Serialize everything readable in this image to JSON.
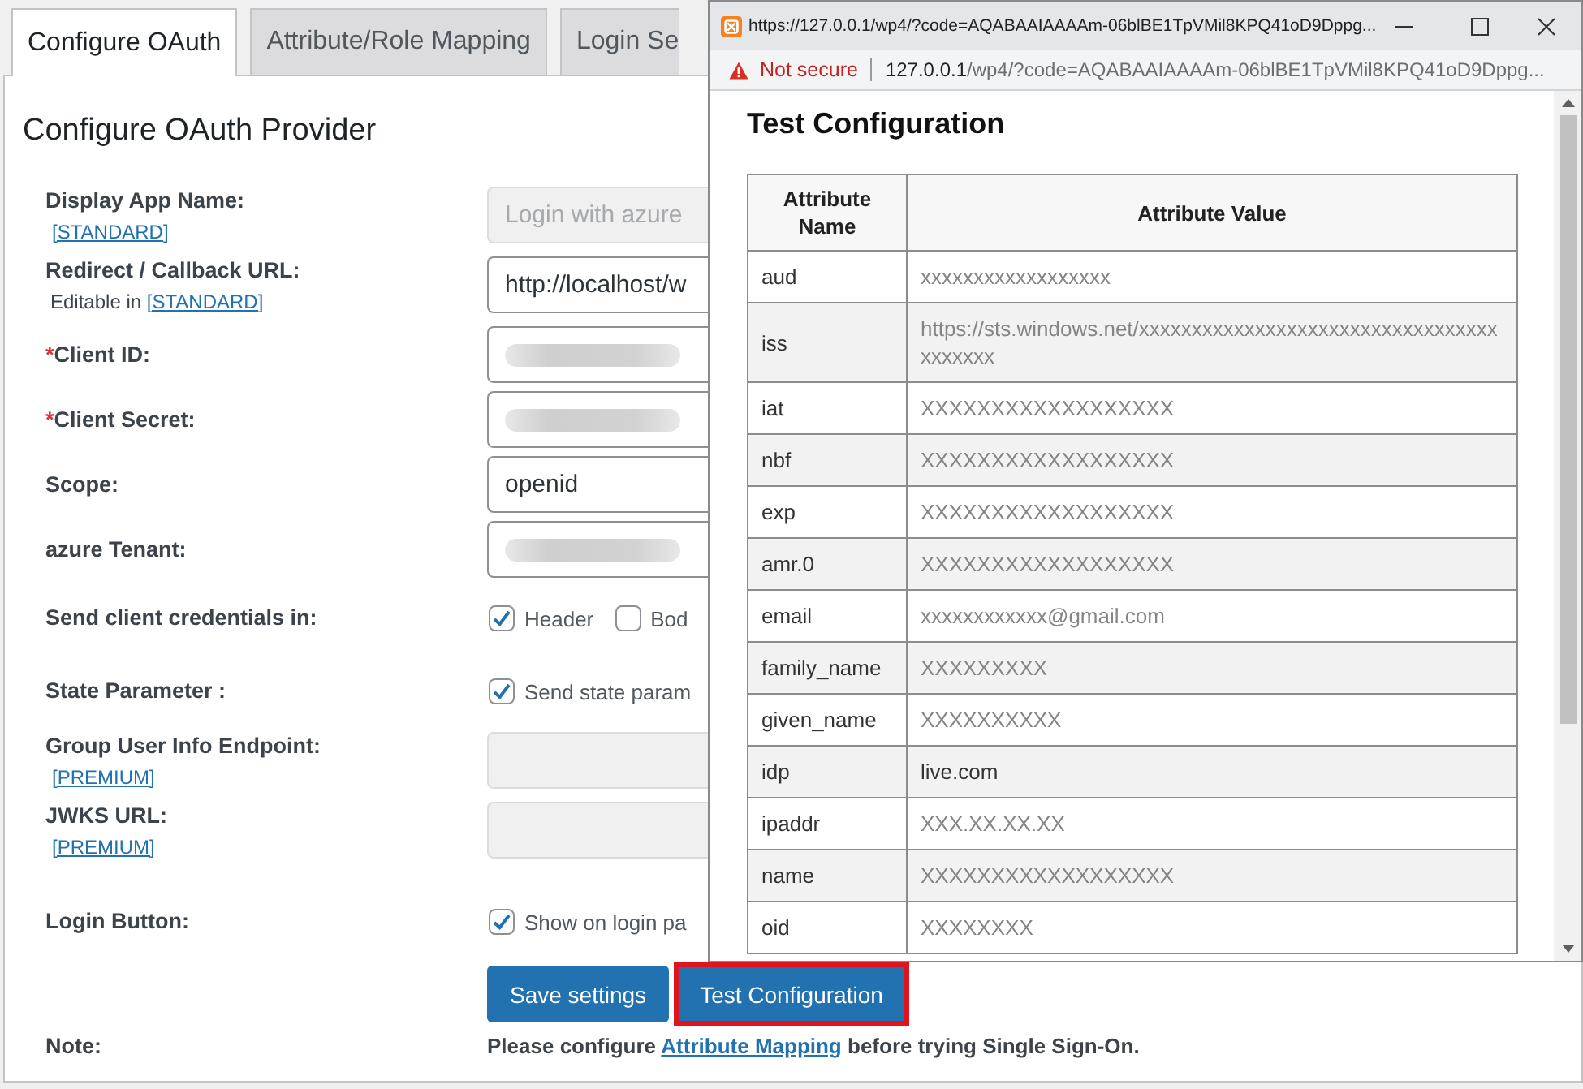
{
  "tabs": [
    {
      "label": "Configure OAuth",
      "selected": true
    },
    {
      "label": "Attribute/Role Mapping",
      "selected": false
    },
    {
      "label": "Login Se",
      "selected": false
    }
  ],
  "panel": {
    "title": "Configure OAuth Provider",
    "fields": [
      {
        "kind": "text",
        "label": "Display App Name:",
        "link": "[STANDARD]",
        "placeholder": "Login with azure",
        "disabled": true
      },
      {
        "kind": "text",
        "label": "Redirect / Callback URL:",
        "note": "Editable in",
        "link": "[STANDARD]",
        "value": "http://localhost/w",
        "disabled": false
      },
      {
        "kind": "secret",
        "label": "Client ID:",
        "required_mark": "*"
      },
      {
        "kind": "secret",
        "label": "Client Secret:",
        "required_mark": "*"
      },
      {
        "kind": "text",
        "label": "Scope:",
        "value": "openid",
        "disabled": false
      },
      {
        "kind": "secret",
        "label": "azure Tenant:"
      },
      {
        "kind": "checkboxes",
        "label": "Send client credentials in:",
        "options": [
          {
            "label": "Header",
            "checked": true
          },
          {
            "label": "Bod",
            "checked": false
          }
        ]
      },
      {
        "kind": "checkboxes",
        "label": "State Parameter :",
        "options": [
          {
            "label": "Send state param",
            "checked": true
          }
        ]
      },
      {
        "kind": "text",
        "label": "Group User Info Endpoint:",
        "link": "[PREMIUM]",
        "disabled": true
      },
      {
        "kind": "text",
        "label": "JWKS URL:",
        "link": "[PREMIUM]",
        "disabled": true
      },
      {
        "kind": "checkboxes",
        "label": "Login Button:",
        "options": [
          {
            "label": "Show on login pa",
            "checked": true
          }
        ]
      }
    ]
  },
  "buttons": [
    {
      "label": "Save settings",
      "highlighted": false
    },
    {
      "label": "Test Configuration",
      "highlighted": true
    }
  ],
  "note": {
    "label": "Note:",
    "before": "Please configure",
    "link": "Attribute Mapping",
    "after": "before trying Single Sign-On."
  },
  "popup": {
    "tab_url": "https://127.0.0.1/wp4/?code=AQABAAIAAAAm-06blBE1TpVMil8KPQ41oD9Dppg...",
    "security": "Not secure",
    "address": {
      "host": "127.0.0.1",
      "path": "/wp4/?code=AQABAAIAAAAm-06blBE1TpVMil8KPQ41oD9Dppg..."
    },
    "heading": "Test Configuration",
    "table": {
      "columns": [
        "Attribute Name",
        "Attribute Value"
      ],
      "rows": [
        {
          "name": "aud",
          "value": "xxxxxxxxxxxxxxxxxx",
          "masked": true
        },
        {
          "name": "iss",
          "value": "https://sts.windows.net/xxxxxxxxxxxxxxxxxxxxxxxxxxxxxxxxxxxxxxxxx",
          "masked": true
        },
        {
          "name": "iat",
          "value": "XXXXXXXXXXXXXXXXXX",
          "masked": true
        },
        {
          "name": "nbf",
          "value": "XXXXXXXXXXXXXXXXXX",
          "masked": true
        },
        {
          "name": "exp",
          "value": "XXXXXXXXXXXXXXXXXX",
          "masked": true
        },
        {
          "name": "amr.0",
          "value": "XXXXXXXXXXXXXXXXXX",
          "masked": true
        },
        {
          "name": "email",
          "value": "xxxxxxxxxxxx@gmail.com",
          "masked": true
        },
        {
          "name": "family_name",
          "value": "XXXXXXXXX",
          "masked": true
        },
        {
          "name": "given_name",
          "value": "XXXXXXXXXX",
          "masked": true
        },
        {
          "name": "idp",
          "value": "live.com",
          "masked": false
        },
        {
          "name": "ipaddr",
          "value": "XXX.XX.XX.XX",
          "masked": true
        },
        {
          "name": "name",
          "value": "XXXXXXXXXXXXXXXXXX",
          "masked": true
        },
        {
          "name": "oid",
          "value": "XXXXXXXX",
          "masked": true
        }
      ]
    }
  }
}
